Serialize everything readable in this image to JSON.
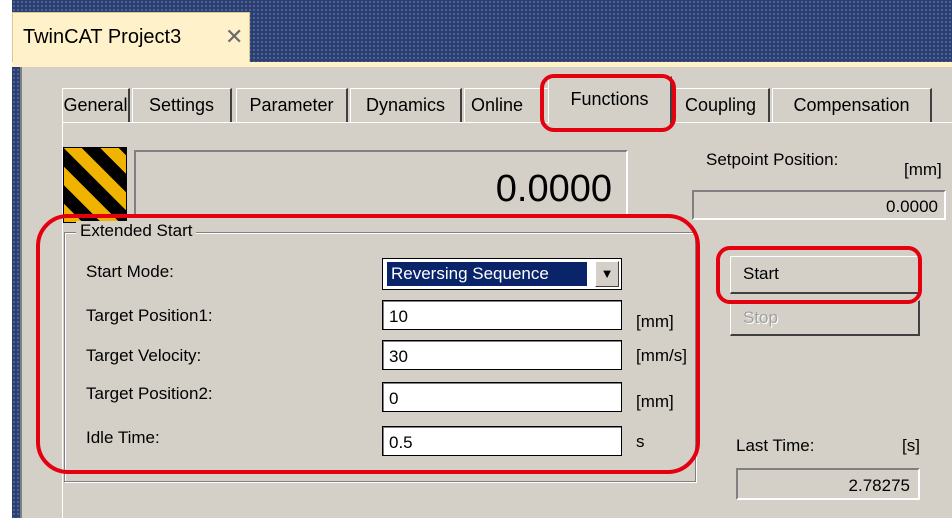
{
  "document_tab": {
    "title": "TwinCAT Project3",
    "close_glyph": "✕"
  },
  "tabs": [
    {
      "label": "General"
    },
    {
      "label": "Settings"
    },
    {
      "label": "Parameter"
    },
    {
      "label": "Dynamics"
    },
    {
      "label": "Online"
    },
    {
      "label": "Functions",
      "active": true
    },
    {
      "label": "Coupling"
    },
    {
      "label": "Compensation"
    }
  ],
  "actual_position": {
    "value": "0.0000"
  },
  "setpoint": {
    "label": "Setpoint Position:",
    "unit": "[mm]",
    "value": "0.0000"
  },
  "extended_start": {
    "title": "Extended Start",
    "start_mode": {
      "label": "Start Mode:",
      "value": "Reversing Sequence"
    },
    "target_position1": {
      "label": "Target Position1:",
      "value": "10",
      "unit": "[mm]"
    },
    "target_velocity": {
      "label": "Target Velocity:",
      "value": "30",
      "unit": "[mm/s]"
    },
    "target_position2": {
      "label": "Target Position2:",
      "value": "0",
      "unit": "[mm]"
    },
    "idle_time": {
      "label": "Idle Time:",
      "value": "0.5",
      "unit": "s"
    }
  },
  "buttons": {
    "start": "Start",
    "stop": "Stop"
  },
  "last_time": {
    "label": "Last Time:",
    "unit": "[s]",
    "value": "2.78275"
  },
  "colors": {
    "highlight": "#e3000f",
    "selection": "#0a246a",
    "panel": "#d4d0c8",
    "doc_tab": "#fff1c9",
    "hatch_yellow": "#f0b400"
  }
}
